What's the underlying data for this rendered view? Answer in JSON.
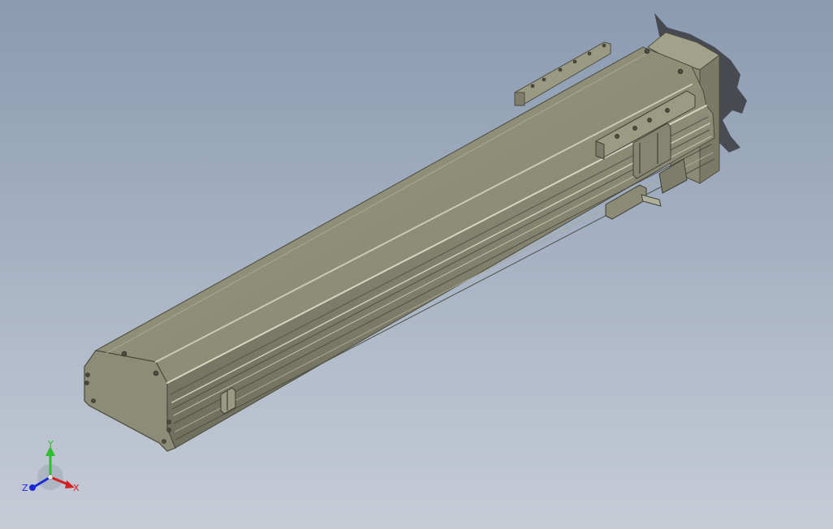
{
  "scene": {
    "model": "linear-actuator-module",
    "background_top": "#8a9ab0",
    "background_bottom": "#c6ccd6",
    "body_color": "#8f8f7b"
  },
  "triad": {
    "y_label": "Y",
    "z_label": "Z",
    "x_label": "X",
    "y_color": "#2fbf2f",
    "z_color": "#1d2bd6",
    "x_color": "#d42020"
  }
}
